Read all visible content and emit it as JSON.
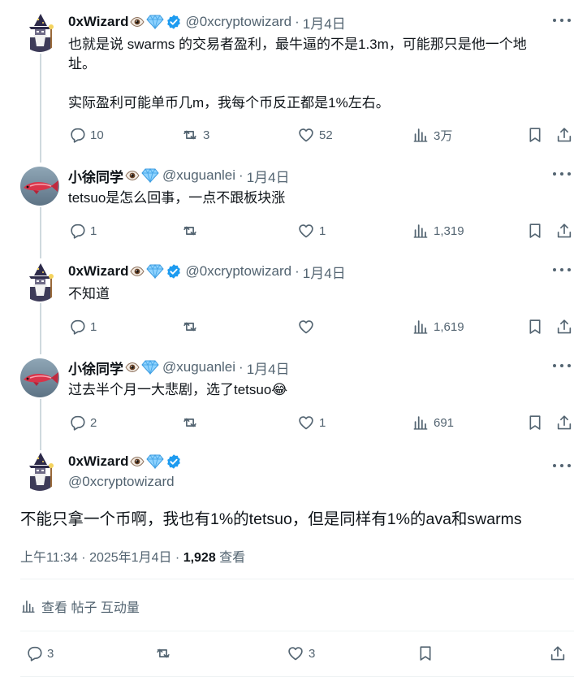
{
  "tweets": [
    {
      "name": "0xWizard",
      "handle": "@0xcryptowizard",
      "date": "1月4日",
      "sep": "·",
      "verified": true,
      "avatar": "wizard",
      "lines": [
        "也就是说 swarms 的交易者盈利，最牛逼的不是1.3m，可能那只是他一个地",
        "址。",
        "",
        "实际盈利可能单币几m，我每个币反正都是1%左右。"
      ],
      "stats": {
        "replies": "10",
        "reposts": "3",
        "likes": "52",
        "views": "3万"
      }
    },
    {
      "name": "小徐同学",
      "handle": "@xuguanlei",
      "date": "1月4日",
      "sep": "·",
      "verified": false,
      "avatar": "fish",
      "lines": [
        "tetsuo是怎么回事，一点不跟板块涨"
      ],
      "stats": {
        "replies": "1",
        "reposts": "",
        "likes": "1",
        "views": "1,319"
      }
    },
    {
      "name": "0xWizard",
      "handle": "@0xcryptowizard",
      "date": "1月4日",
      "sep": "·",
      "verified": true,
      "avatar": "wizard",
      "lines": [
        "不知道"
      ],
      "stats": {
        "replies": "1",
        "reposts": "",
        "likes": "",
        "views": "1,619"
      }
    },
    {
      "name": "小徐同学",
      "handle": "@xuguanlei",
      "date": "1月4日",
      "sep": "·",
      "verified": false,
      "avatar": "fish",
      "lines": [
        "过去半个月一大悲剧，选了tetsuo😂"
      ],
      "stats": {
        "replies": "2",
        "reposts": "",
        "likes": "1",
        "views": "691"
      }
    }
  ],
  "main": {
    "name": "0xWizard",
    "handle": "@0xcryptowizard",
    "text": "不能只拿一个币啊，我也有1%的tetsuo，但是同样有1%的ava和swarms",
    "timestamp": "上午11:34 · 2025年1月4日 · ",
    "views_count": "1,928",
    "views_label": " 查看",
    "engagement_label": "查看 帖子 互动量",
    "stats": {
      "replies": "3",
      "reposts": "",
      "likes": "3"
    }
  },
  "colors": {
    "text": "#0f1419",
    "secondary": "#536471",
    "verified": "#1d9bf0",
    "line": "#cfd9de",
    "divider": "#eff3f4"
  },
  "icons": [
    "eye-icon",
    "diamond-icon",
    "verified-icon",
    "reply-icon",
    "repost-icon",
    "like-icon",
    "views-icon",
    "bookmark-icon",
    "share-icon",
    "more-icon"
  ]
}
